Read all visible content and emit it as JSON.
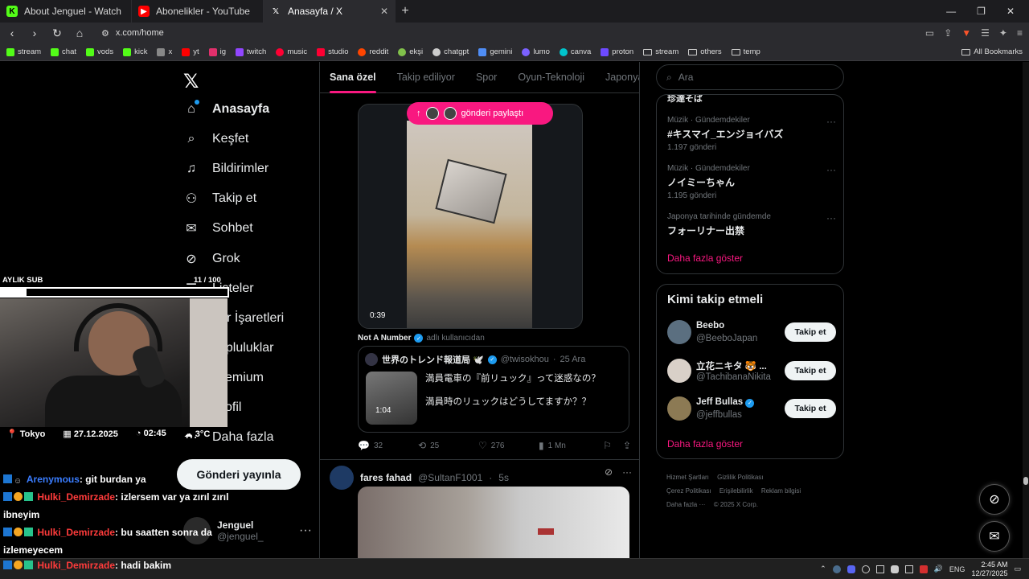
{
  "browser": {
    "tabs": [
      {
        "title": "About Jenguel - Watch Live on Kick",
        "favicon": "kick-icon",
        "color": "#53fc18",
        "active": false
      },
      {
        "title": "Abonelikler - YouTube",
        "favicon": "youtube-icon",
        "color": "#ff0000",
        "active": false
      },
      {
        "title": "Anasayfa / X",
        "favicon": "x-icon",
        "color": "#ffffff",
        "active": true
      }
    ],
    "url": "x.com/home",
    "bookmarks": [
      {
        "label": "stream",
        "color": "#53fc18"
      },
      {
        "label": "chat",
        "color": "#53fc18"
      },
      {
        "label": "vods",
        "color": "#53fc18"
      },
      {
        "label": "kick",
        "color": "#53fc18"
      },
      {
        "label": "x",
        "color": "#888888"
      },
      {
        "label": "yt",
        "color": "#ff0000"
      },
      {
        "label": "ig",
        "color": "#e1306c"
      },
      {
        "label": "twitch",
        "color": "#9146ff"
      },
      {
        "label": "music",
        "color": "#ff0033"
      },
      {
        "label": "studio",
        "color": "#ff0033"
      },
      {
        "label": "reddit",
        "color": "#ff4500"
      },
      {
        "label": "ekşi",
        "color": "#81c14b"
      },
      {
        "label": "chatgpt",
        "color": "#cccccc"
      },
      {
        "label": "gemini",
        "color": "#4f8df5"
      },
      {
        "label": "lumo",
        "color": "#7b61ff"
      },
      {
        "label": "canva",
        "color": "#00c4cc"
      },
      {
        "label": "proton",
        "color": "#6d4aff"
      },
      {
        "label": "stream",
        "color": "folder"
      },
      {
        "label": "others",
        "color": "folder"
      },
      {
        "label": "temp",
        "color": "folder"
      }
    ],
    "all_bookmarks": "All Bookmarks"
  },
  "x": {
    "nav": [
      {
        "label": "Anasayfa",
        "icon": "home-icon",
        "glyph": "⌂",
        "active": true
      },
      {
        "label": "Keşfet",
        "icon": "search-icon",
        "glyph": "⌕",
        "active": false
      },
      {
        "label": "Bildirimler",
        "icon": "bell-icon",
        "glyph": "♫",
        "active": false
      },
      {
        "label": "Takip et",
        "icon": "person-add-icon",
        "glyph": "⚇",
        "active": false
      },
      {
        "label": "Sohbet",
        "icon": "mail-icon",
        "glyph": "✉",
        "active": false
      },
      {
        "label": "Grok",
        "icon": "grok-icon",
        "glyph": "⊘",
        "active": false
      },
      {
        "label": "Listeler",
        "icon": "list-icon",
        "glyph": "☰",
        "active": false
      },
      {
        "label": "Yer İşaretleri",
        "icon": "bookmark-icon",
        "glyph": "⚐",
        "active": false
      },
      {
        "label": "Topluluklar",
        "icon": "communities-icon",
        "glyph": "⚯",
        "active": false
      },
      {
        "label": "Premium",
        "icon": "premium-icon",
        "glyph": "✕",
        "active": false
      },
      {
        "label": "Profil",
        "icon": "profile-icon",
        "glyph": "☺",
        "active": false
      },
      {
        "label": "Daha fazla",
        "icon": "more-icon",
        "glyph": "⋯",
        "active": false
      }
    ],
    "post_button": "Gönderi yayınla",
    "profile": {
      "name": "Jenguel",
      "handle": "@jenguel_"
    },
    "feed_tabs": [
      "Sana özel",
      "Takip ediliyor",
      "Spor",
      "Oyun-Teknoloji",
      "Japonya"
    ],
    "post1": {
      "share_pill": "gönderi paylaştı",
      "video_duration": "0:39",
      "quote_author": "Not A Number",
      "quote_suffix": "adlı kullanıcıdan",
      "quoted": {
        "name": "世界のトレンド報道局 🕊️",
        "handle": "@twisokhou",
        "date": "25 Ara",
        "line1": "満員電車の『前リュック』って迷惑なの？",
        "line2": "満員時のリュックはどうしてますか？？",
        "thumb_duration": "1:04"
      },
      "stats": {
        "replies": "32",
        "reposts": "25",
        "likes": "276",
        "views": "1 Mn"
      }
    },
    "post2": {
      "name": "fares fahad",
      "handle": "@SultanF1001",
      "time": "5s"
    },
    "search_placeholder": "Ara",
    "trends_cut_top": "珍達そば",
    "trends": [
      {
        "category": "Müzik · Gündemdekiler",
        "name": "#キスマイ_エンジョイバズ",
        "count": "1.197 gönderi"
      },
      {
        "category": "Müzik · Gündemdekiler",
        "name": "ノイミーちゃん",
        "count": "1.195 gönderi"
      },
      {
        "category": "Japonya tarihinde gündemde",
        "name": "フォーリナー出禁",
        "count": ""
      }
    ],
    "show_more": "Daha fazla göster",
    "who_to_follow_title": "Kimi takip etmeli",
    "follow_label": "Takip et",
    "who_to_follow": [
      {
        "name": "Beebo",
        "handle": "@BeeboJapan",
        "verified": false,
        "color": "#5b6f80"
      },
      {
        "name": "立花ニキタ 🐯 ...",
        "handle": "@TachibanaNikita",
        "verified": false,
        "color": "#d9d0c8"
      },
      {
        "name": "Jeff Bullas",
        "handle": "@jeffbullas",
        "verified": true,
        "color": "#8c7a54"
      }
    ],
    "footer_links": [
      "Hizmet Şartları",
      "Gizlilik Politikası",
      "Çerez Politikası",
      "Erişilebilirlik",
      "Reklam bilgisi",
      "Daha fazla ···",
      "© 2025 X Corp."
    ]
  },
  "overlay": {
    "sub_label": "AYLIK SUB",
    "sub_count": "11  / 100",
    "sub_progress": 0.11,
    "location": "Tokyo",
    "date": "27.12.2025",
    "time": "02:45",
    "temp": "3°C",
    "chat": [
      {
        "user": "Arenymous",
        "color": "blue",
        "message": ": git burdan ya"
      },
      {
        "user": "Hulki_Demirzade",
        "color": "red",
        "message": ": izlersem var ya zırıl zırıl ibneyim"
      },
      {
        "user": "Hulki_Demirzade",
        "color": "red",
        "message": ": bu saatten sonra da izlemeyecem"
      },
      {
        "user": "Hulki_Demirzade",
        "color": "red",
        "message": ": hadi bakim"
      }
    ]
  },
  "taskbar": {
    "lang": "ENG",
    "time": "2:45 AM",
    "date": "12/27/2025"
  }
}
